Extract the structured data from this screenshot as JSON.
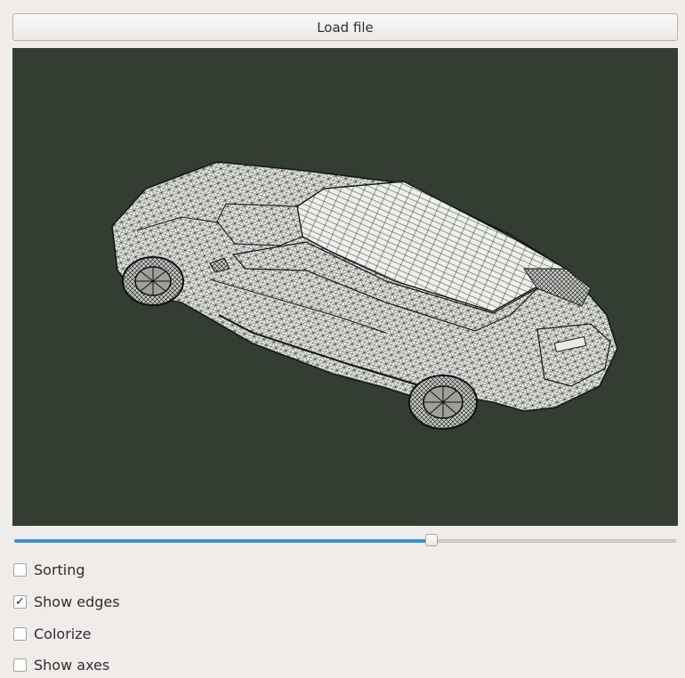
{
  "toolbar": {
    "load_label": "Load file"
  },
  "viewport": {
    "background_color": "#333d32",
    "model": "car-wireframe"
  },
  "slider": {
    "value_fraction": 0.63,
    "accent_color": "#3b8fd4"
  },
  "options": [
    {
      "label": "Sorting",
      "checked": false
    },
    {
      "label": "Show edges",
      "checked": true
    },
    {
      "label": "Colorize",
      "checked": false
    },
    {
      "label": "Show axes",
      "checked": false
    }
  ],
  "check_glyph": "✓"
}
